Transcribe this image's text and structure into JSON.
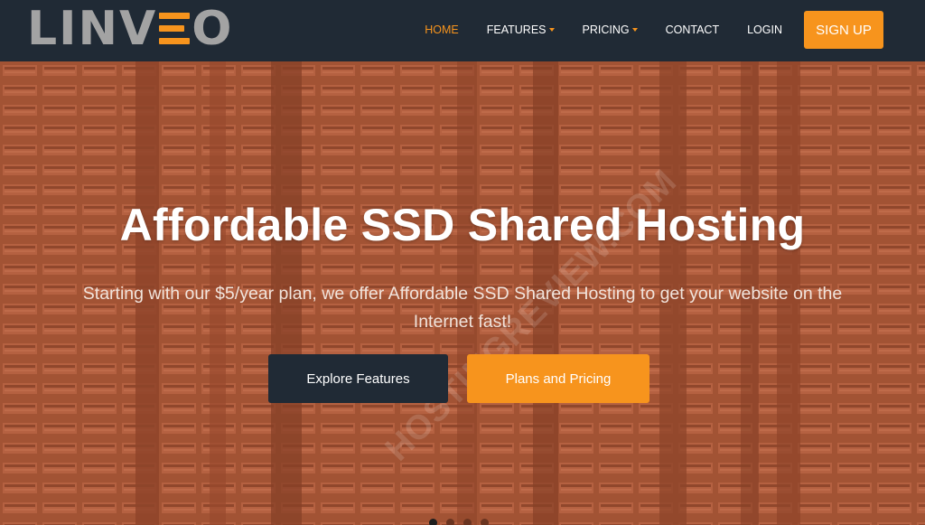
{
  "brand": {
    "logo_text_left": "LINV",
    "logo_text_right": "O"
  },
  "nav": {
    "items": [
      {
        "label": "HOME",
        "active": true,
        "dropdown": false
      },
      {
        "label": "FEATURES",
        "active": false,
        "dropdown": true
      },
      {
        "label": "PRICING",
        "active": false,
        "dropdown": true
      },
      {
        "label": "CONTACT",
        "active": false,
        "dropdown": false
      },
      {
        "label": "LOGIN",
        "active": false,
        "dropdown": false
      }
    ],
    "signup_label": "SIGN UP"
  },
  "hero": {
    "title": "Affordable SSD Shared Hosting",
    "subtitle": "Starting with our $5/year plan, we offer Affordable SSD Shared Hosting to get your website on the Internet fast!",
    "primary_button": "Explore Features",
    "secondary_button": "Plans and Pricing",
    "watermark": "HOSTINGREVIEW.COM",
    "slider": {
      "total": 4,
      "active_index": 0
    }
  },
  "colors": {
    "accent": "#f7941d",
    "nav_bg": "#202a35",
    "hero_tint": "#a05535"
  },
  "icons": {
    "dropdown": "caret-down-icon"
  }
}
